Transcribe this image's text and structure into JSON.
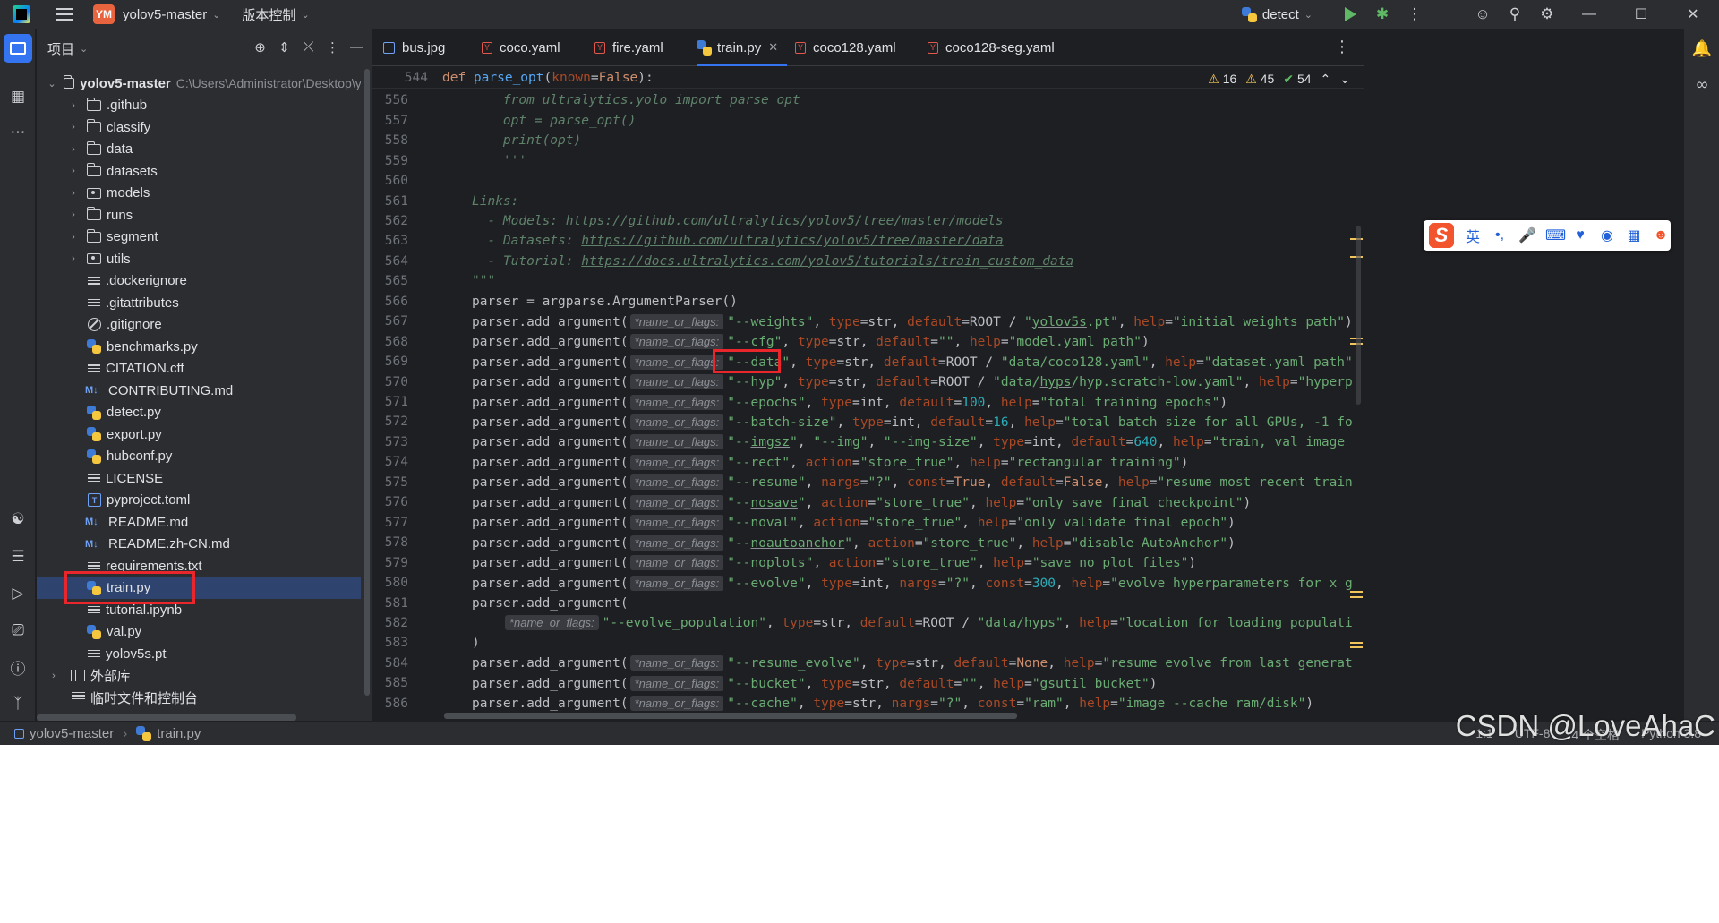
{
  "titlebar": {
    "project_badge": "YM",
    "project_name": "yolov5-master",
    "vcs_label": "版本控制",
    "run_config": "detect"
  },
  "project_panel": {
    "title": "项目",
    "root_name": "yolov5-master",
    "root_path": "C:\\Users\\Administrator\\Desktop\\yolov5-master",
    "items": [
      {
        "label": ".github",
        "icon": "folder-icon"
      },
      {
        "label": "classify",
        "icon": "folder-icon"
      },
      {
        "label": "data",
        "icon": "folder-icon"
      },
      {
        "label": "datasets",
        "icon": "folder-icon"
      },
      {
        "label": "models",
        "icon": "package-icon"
      },
      {
        "label": "runs",
        "icon": "folder-icon"
      },
      {
        "label": "segment",
        "icon": "folder-icon"
      },
      {
        "label": "utils",
        "icon": "package-icon"
      },
      {
        "label": ".dockerignore",
        "icon": "text-file-icon"
      },
      {
        "label": ".gitattributes",
        "icon": "text-file-icon"
      },
      {
        "label": ".gitignore",
        "icon": "ignore-file-icon"
      },
      {
        "label": "benchmarks.py",
        "icon": "python-file-icon"
      },
      {
        "label": "CITATION.cff",
        "icon": "text-file-icon"
      },
      {
        "label": "CONTRIBUTING.md",
        "icon": "markdown-file-icon"
      },
      {
        "label": "detect.py",
        "icon": "python-file-icon"
      },
      {
        "label": "export.py",
        "icon": "python-file-icon"
      },
      {
        "label": "hubconf.py",
        "icon": "python-file-icon"
      },
      {
        "label": "LICENSE",
        "icon": "text-file-icon"
      },
      {
        "label": "pyproject.toml",
        "icon": "toml-file-icon"
      },
      {
        "label": "README.md",
        "icon": "markdown-file-icon"
      },
      {
        "label": "README.zh-CN.md",
        "icon": "markdown-file-icon"
      },
      {
        "label": "requirements.txt",
        "icon": "text-file-icon"
      },
      {
        "label": "train.py",
        "icon": "python-file-icon"
      },
      {
        "label": "tutorial.ipynb",
        "icon": "text-file-icon"
      },
      {
        "label": "val.py",
        "icon": "python-file-icon"
      },
      {
        "label": "yolov5s.pt",
        "icon": "text-file-icon"
      }
    ],
    "external_libs": "外部库",
    "scratches": "临时文件和控制台"
  },
  "tabs": [
    {
      "label": "bus.jpg"
    },
    {
      "label": "coco.yaml"
    },
    {
      "label": "fire.yaml"
    },
    {
      "label": "train.py"
    },
    {
      "label": "coco128.yaml"
    },
    {
      "label": "coco128-seg.yaml"
    }
  ],
  "editor": {
    "sticky_line": "544",
    "inspections": {
      "errors": "16",
      "warnings": "45",
      "ok": "54"
    },
    "hint": "*name_or_flags:",
    "line_numbers": [
      "556",
      "557",
      "558",
      "559",
      "560",
      "561",
      "562",
      "563",
      "564",
      "565",
      "566",
      "567",
      "568",
      "569",
      "570",
      "571",
      "572",
      "573",
      "574",
      "575",
      "576",
      "577",
      "578",
      "579",
      "580",
      "581",
      "582",
      "583",
      "584",
      "585",
      "586"
    ]
  },
  "ime": {
    "mode": "英"
  },
  "statusbar": {
    "crumb_project": "yolov5-master",
    "crumb_file": "train.py",
    "position": "1:1",
    "encoding": "UTF-8",
    "indent": "4 个空格",
    "interpreter": "Python 3.8"
  },
  "watermark": "CSDN @LoveAhaC",
  "colors": {
    "accent": "#3574f0",
    "highlight": "#e8262b",
    "keyword": "#cf8e6d",
    "string": "#6aab73"
  }
}
